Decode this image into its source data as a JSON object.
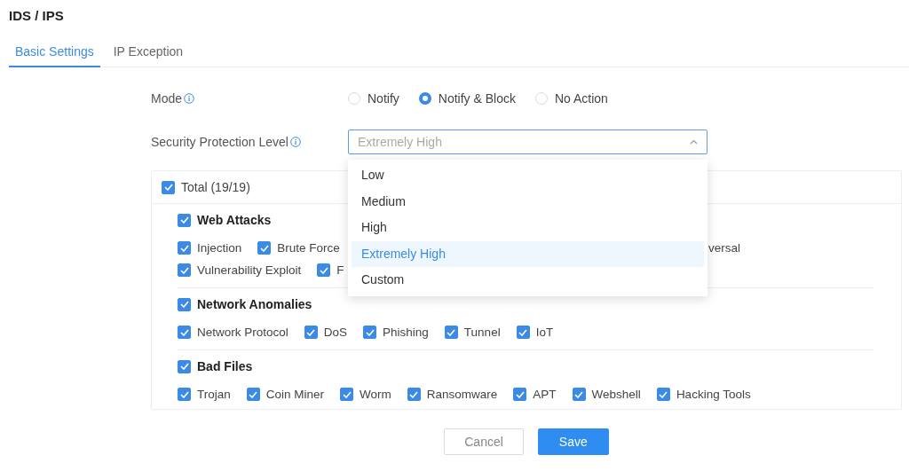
{
  "page": {
    "title": "IDS / IPS"
  },
  "tabs": [
    {
      "label": "Basic Settings",
      "selected": true
    },
    {
      "label": "IP Exception",
      "selected": false
    }
  ],
  "mode": {
    "label": "Mode",
    "options": [
      {
        "label": "Notify",
        "selected": false
      },
      {
        "label": "Notify & Block",
        "selected": true
      },
      {
        "label": "No Action",
        "selected": false
      }
    ]
  },
  "protection_level": {
    "label": "Security Protection Level",
    "value": "Extremely High",
    "expanded": true,
    "options": [
      {
        "label": "Low",
        "selected": false
      },
      {
        "label": "Medium",
        "selected": false
      },
      {
        "label": "High",
        "selected": false
      },
      {
        "label": "Extremely High",
        "selected": true
      },
      {
        "label": "Custom",
        "selected": false
      }
    ]
  },
  "categories": {
    "total": {
      "label": "Total (19/19)",
      "checked": true
    },
    "groups": [
      {
        "label": "Web Attacks",
        "checked": true,
        "rows": [
          [
            {
              "kind": "full",
              "label": "Injection",
              "checked": true
            },
            {
              "kind": "full",
              "label": "Brute Force",
              "checked": true
            },
            {
              "kind": "tail",
              "label": "versal"
            }
          ],
          [
            {
              "kind": "full",
              "label": "Vulnerability Exploit",
              "checked": true
            },
            {
              "kind": "full",
              "label": "F",
              "checked": true
            }
          ]
        ]
      },
      {
        "label": "Network Anomalies",
        "checked": true,
        "rows": [
          [
            {
              "kind": "full",
              "label": "Network Protocol",
              "checked": true
            },
            {
              "kind": "full",
              "label": "DoS",
              "checked": true
            },
            {
              "kind": "full",
              "label": "Phishing",
              "checked": true
            },
            {
              "kind": "full",
              "label": "Tunnel",
              "checked": true
            },
            {
              "kind": "full",
              "label": "IoT",
              "checked": true
            }
          ]
        ]
      },
      {
        "label": "Bad Files",
        "checked": true,
        "rows": [
          [
            {
              "kind": "full",
              "label": "Trojan",
              "checked": true
            },
            {
              "kind": "full",
              "label": "Coin Miner",
              "checked": true
            },
            {
              "kind": "full",
              "label": "Worm",
              "checked": true
            },
            {
              "kind": "full",
              "label": "Ransomware",
              "checked": true
            },
            {
              "kind": "full",
              "label": "APT",
              "checked": true
            },
            {
              "kind": "full",
              "label": "Webshell",
              "checked": true
            },
            {
              "kind": "full",
              "label": "Hacking Tools",
              "checked": true
            }
          ]
        ]
      }
    ]
  },
  "buttons": [
    {
      "label": "Cancel",
      "kind": "secondary"
    },
    {
      "label": "Save",
      "kind": "primary"
    }
  ]
}
